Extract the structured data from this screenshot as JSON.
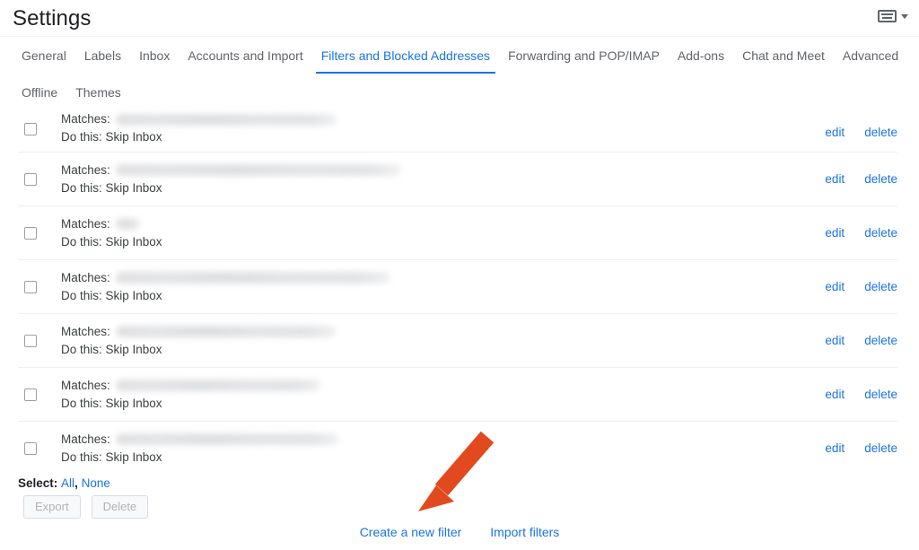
{
  "header": {
    "title": "Settings",
    "input_tools_icon": "keyboard-icon",
    "dropdown_icon": "chevron-down-icon"
  },
  "tabs": [
    {
      "label": "General",
      "active": false
    },
    {
      "label": "Labels",
      "active": false
    },
    {
      "label": "Inbox",
      "active": false
    },
    {
      "label": "Accounts and Import",
      "active": false
    },
    {
      "label": "Filters and Blocked Addresses",
      "active": true
    },
    {
      "label": "Forwarding and POP/IMAP",
      "active": false
    },
    {
      "label": "Add-ons",
      "active": false
    },
    {
      "label": "Chat and Meet",
      "active": false
    },
    {
      "label": "Advanced",
      "active": false
    },
    {
      "label": "Offline",
      "active": false
    },
    {
      "label": "Themes",
      "active": false
    }
  ],
  "filters": {
    "matches_label": "Matches:",
    "action_label": "Do this: Skip Inbox",
    "edit_label": "edit",
    "delete_label": "delete",
    "rows": [
      {
        "redacted_width": 246,
        "clipped": true
      },
      {
        "redacted_width": 318,
        "clipped": false
      },
      {
        "redacted_width": 26,
        "clipped": false
      },
      {
        "redacted_width": 306,
        "clipped": false
      },
      {
        "redacted_width": 245,
        "clipped": false
      },
      {
        "redacted_width": 228,
        "clipped": false
      },
      {
        "redacted_width": 248,
        "clipped": false
      }
    ]
  },
  "select_bar": {
    "label": "Select:",
    "all_label": "All",
    "separator": ",",
    "none_label": "None"
  },
  "buttons": {
    "export_label": "Export",
    "delete_label": "Delete"
  },
  "bottom_links": {
    "create_label": "Create a new filter",
    "import_label": "Import filters"
  },
  "annotation": {
    "arrow_color": "#E2491E",
    "arrow_name": "red-arrow-pointing-to-create-a-new-filter"
  },
  "colors": {
    "accent_blue": "#1a73e8",
    "text_primary": "#202124",
    "text_secondary": "#5f6368",
    "divider": "#eceff1",
    "background": "#ffffff"
  }
}
